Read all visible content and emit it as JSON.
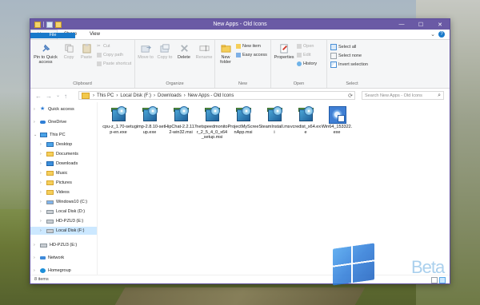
{
  "window": {
    "title": "New Apps - Old Icons",
    "controls": [
      "—",
      "☐",
      "✕"
    ]
  },
  "tabs": [
    {
      "label": "File"
    },
    {
      "label": "Home"
    },
    {
      "label": "Share"
    },
    {
      "label": "View"
    }
  ],
  "help": {
    "chevron": "⌄",
    "label": "?"
  },
  "ribbon": {
    "clipboard": {
      "pin": "Pin to Quick access",
      "copy": "Copy",
      "paste": "Paste",
      "cut": "Cut",
      "copy_path": "Copy path",
      "paste_shortcut": "Paste shortcut",
      "label": "Clipboard"
    },
    "organize": {
      "move_to": "Move to",
      "copy_to": "Copy to",
      "delete": "Delete",
      "rename": "Rename",
      "label": "Organize"
    },
    "new": {
      "new_folder": "New folder",
      "new_item": "New item",
      "easy_access": "Easy access",
      "label": "New"
    },
    "open": {
      "properties": "Properties",
      "open": "Open",
      "edit": "Edit",
      "history": "History",
      "label": "Open"
    },
    "select": {
      "select_all": "Select all",
      "select_none": "Select none",
      "invert": "Invert selection",
      "label": "Select"
    }
  },
  "address": {
    "crumbs": [
      "This PC",
      "Local Disk (F:)",
      "Downloads",
      "New Apps - Old Icons"
    ],
    "search_placeholder": "Search New Apps - Old Icons"
  },
  "nav": {
    "quick_access": "Quick access",
    "onedrive": "OneDrive",
    "this_pc": "This PC",
    "desktop": "Desktop",
    "documents": "Documents",
    "downloads": "Downloads",
    "music": "Music",
    "pictures": "Pictures",
    "videos": "Videos",
    "windows10": "Windows10 (C:)",
    "local_d": "Local Disk (D:)",
    "hdpzu3_e_sub": "HD-PZU3 (E:)",
    "local_f": "Local Disk (F:)",
    "hdpzu3_e": "HD-PZU3 (E:)",
    "network": "Network",
    "homegroup": "Homegroup"
  },
  "files": [
    {
      "name": "cpu-z_1.70-setup-en.exe",
      "icon": "setup-icon"
    },
    {
      "name": "gimp-2.8.10-setup.exe",
      "icon": "setup-icon"
    },
    {
      "name": "HipChat-2.2.1172-win32.msi",
      "icon": "setup-icon"
    },
    {
      "name": "netspeedmonitor_2_5_4_0_x64_setup.msi",
      "icon": "setup-icon"
    },
    {
      "name": "ProjectMyScreenApp.msi",
      "icon": "setup-icon"
    },
    {
      "name": "SteamInstall.msi",
      "icon": "setup-icon"
    },
    {
      "name": "vcredist_x64.exe",
      "icon": "setup-icon"
    },
    {
      "name": "Win64_153322.exe",
      "icon": "windows-app-icon"
    }
  ],
  "status": {
    "count": "8 items"
  },
  "watermark": {
    "text": "Beta"
  }
}
